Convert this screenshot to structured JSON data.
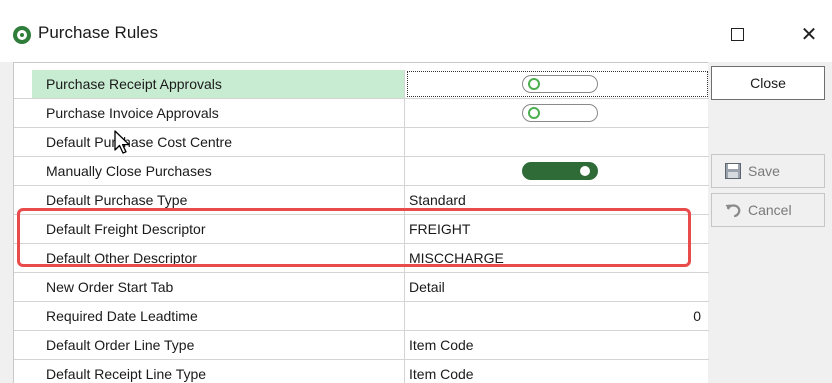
{
  "window": {
    "title": "Purchase Rules",
    "maximize_glyph": "□",
    "close_glyph": "✕"
  },
  "grid": {
    "rows": [
      {
        "name": "Purchase Receipt Approvals",
        "value_type": "toggle",
        "toggle": "off",
        "selected": true
      },
      {
        "name": "Purchase Invoice Approvals",
        "value_type": "toggle",
        "toggle": "off"
      },
      {
        "name": "Default Purchase Cost Centre",
        "value_type": "text",
        "value": ""
      },
      {
        "name": "Manually Close Purchases",
        "value_type": "toggle",
        "toggle": "on"
      },
      {
        "name": "Default Purchase Type",
        "value_type": "text",
        "value": "Standard"
      },
      {
        "name": "Default Freight Descriptor",
        "value_type": "text",
        "value": "FREIGHT"
      },
      {
        "name": "Default Other Descriptor",
        "value_type": "text",
        "value": "MISCCHARGE"
      },
      {
        "name": "New Order Start Tab",
        "value_type": "text",
        "value": "Detail"
      },
      {
        "name": "Required Date Leadtime",
        "value_type": "number",
        "value": "0"
      },
      {
        "name": "Default Order Line Type",
        "value_type": "text",
        "value": "Item Code"
      },
      {
        "name": "Default Receipt Line Type",
        "value_type": "text",
        "value": "Item Code"
      }
    ]
  },
  "buttons": {
    "close_label": "Close",
    "save_label": "Save",
    "cancel_label": "Cancel"
  },
  "colors": {
    "accent_green": "#2e6b36",
    "selected_row": "#c8ecd2",
    "highlight_red": "#e94a4a"
  },
  "icons": {
    "app": "app-logo-icon",
    "save": "floppy-disk-icon",
    "cancel": "undo-arrow-icon"
  }
}
